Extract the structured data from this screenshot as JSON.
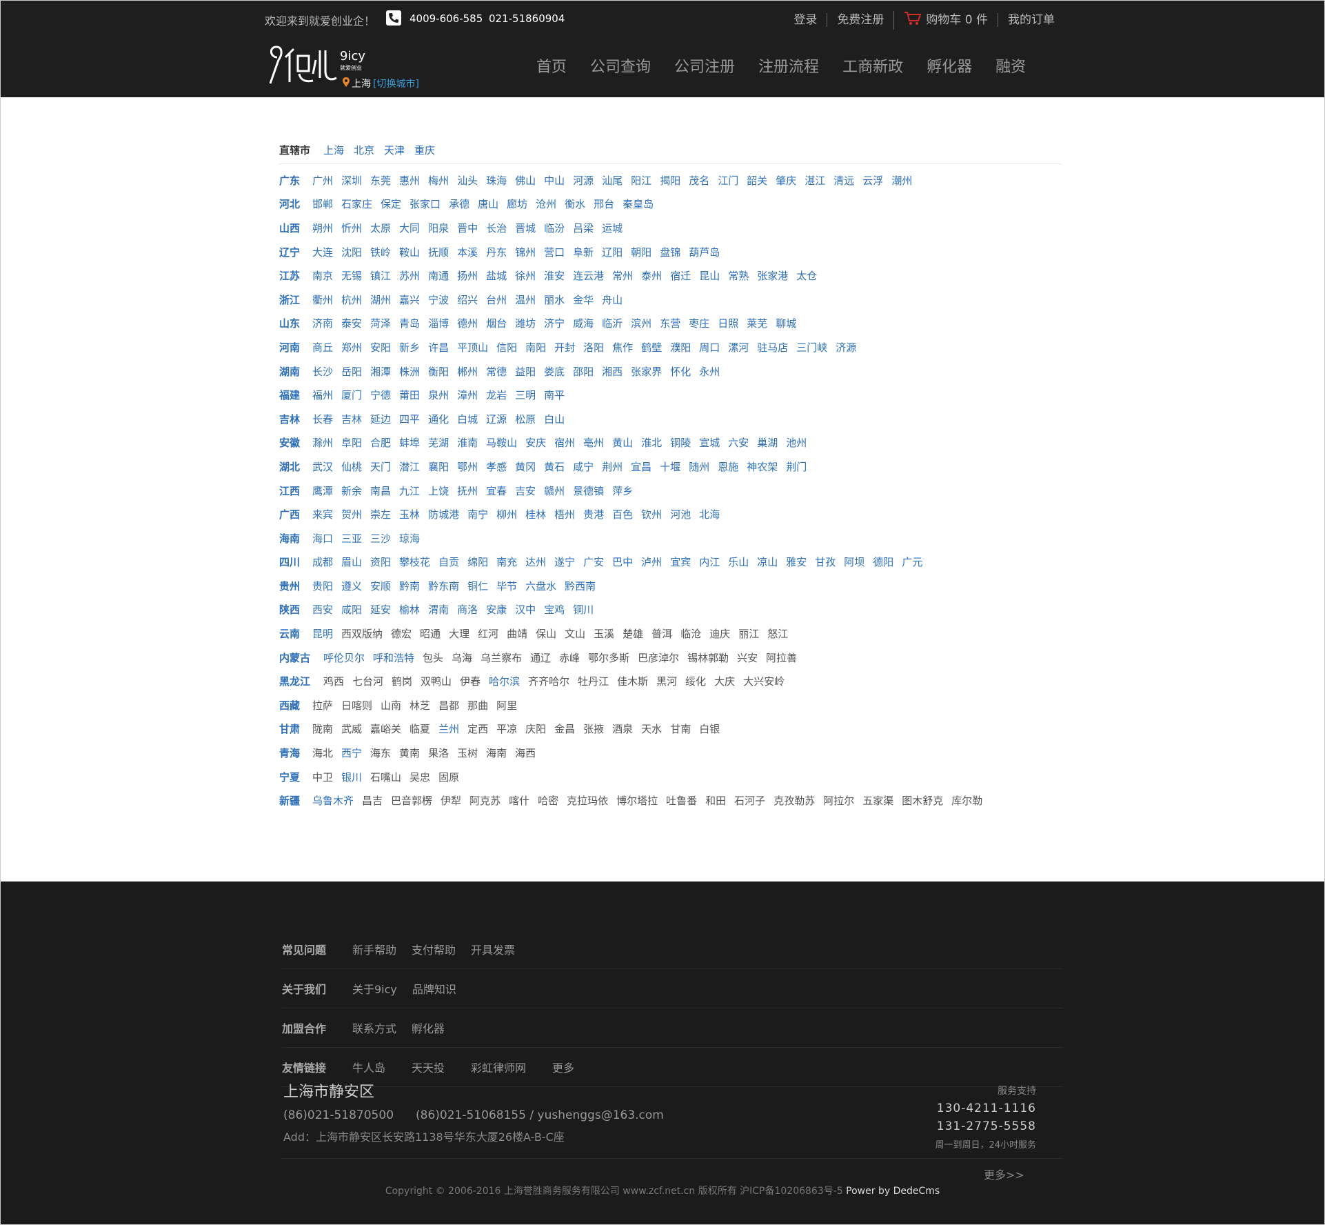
{
  "header": {
    "welcome": "欢迎来到就爱创业企！",
    "phone1": "4009-606-585",
    "phone2": "021-51860904",
    "links": {
      "login": "登录",
      "register": "免费注册",
      "cart": "购物车 0 件",
      "orders": "我的订单"
    },
    "logo_text": "9icy",
    "logo_sub": "就爱创业",
    "city": "上海",
    "switch_city": "[切换城市]",
    "nav": [
      "首页",
      "公司查询",
      "公司注册",
      "注册流程",
      "工商新政",
      "孵化器",
      "融资"
    ]
  },
  "municipalities": {
    "label": "直辖市",
    "cities": [
      "上海",
      "北京",
      "天津",
      "重庆"
    ]
  },
  "provinces": [
    {
      "name": "广东",
      "cities": [
        "广州",
        "深圳",
        "东莞",
        "惠州",
        "梅州",
        "汕头",
        "珠海",
        "佛山",
        "中山",
        "河源",
        "汕尾",
        "阳江",
        "揭阳",
        "茂名",
        "江门",
        "韶关",
        "肇庆",
        "湛江",
        "清远",
        "云浮",
        "潮州"
      ]
    },
    {
      "name": "河北",
      "cities": [
        "邯郸",
        "石家庄",
        "保定",
        "张家口",
        "承德",
        "唐山",
        "廊坊",
        "沧州",
        "衡水",
        "邢台",
        "秦皇岛"
      ]
    },
    {
      "name": "山西",
      "cities": [
        "朔州",
        "忻州",
        "太原",
        "大同",
        "阳泉",
        "晋中",
        "长治",
        "晋城",
        "临汾",
        "吕梁",
        "运城"
      ]
    },
    {
      "name": "辽宁",
      "cities": [
        "大连",
        "沈阳",
        "铁岭",
        "鞍山",
        "抚顺",
        "本溪",
        "丹东",
        "锦州",
        "营口",
        "阜新",
        "辽阳",
        "朝阳",
        "盘锦",
        "葫芦岛"
      ]
    },
    {
      "name": "江苏",
      "cities": [
        "南京",
        "无锡",
        "镇江",
        "苏州",
        "南通",
        "扬州",
        "盐城",
        "徐州",
        "淮安",
        "连云港",
        "常州",
        "泰州",
        "宿迁",
        "昆山",
        "常熟",
        "张家港",
        "太仓"
      ]
    },
    {
      "name": "浙江",
      "cities": [
        "衢州",
        "杭州",
        "湖州",
        "嘉兴",
        "宁波",
        "绍兴",
        "台州",
        "温州",
        "丽水",
        "金华",
        "舟山"
      ]
    },
    {
      "name": "山东",
      "cities": [
        "济南",
        "泰安",
        "菏泽",
        "青岛",
        "淄博",
        "德州",
        "烟台",
        "潍坊",
        "济宁",
        "威海",
        "临沂",
        "滨州",
        "东营",
        "枣庄",
        "日照",
        "莱芜",
        "聊城"
      ]
    },
    {
      "name": "河南",
      "cities": [
        "商丘",
        "郑州",
        "安阳",
        "新乡",
        "许昌",
        "平顶山",
        "信阳",
        "南阳",
        "开封",
        "洛阳",
        "焦作",
        "鹤壁",
        "濮阳",
        "周口",
        "漯河",
        "驻马店",
        "三门峡",
        "济源"
      ]
    },
    {
      "name": "湖南",
      "cities": [
        "长沙",
        "岳阳",
        "湘潭",
        "株洲",
        "衡阳",
        "郴州",
        "常德",
        "益阳",
        "娄底",
        "邵阳",
        "湘西",
        "张家界",
        "怀化",
        "永州"
      ]
    },
    {
      "name": "福建",
      "cities": [
        "福州",
        "厦门",
        "宁德",
        "莆田",
        "泉州",
        "漳州",
        "龙岩",
        "三明",
        "南平"
      ]
    },
    {
      "name": "吉林",
      "cities": [
        "长春",
        "吉林",
        "延边",
        "四平",
        "通化",
        "白城",
        "辽源",
        "松原",
        "白山"
      ]
    },
    {
      "name": "安徽",
      "cities": [
        "滁州",
        "阜阳",
        "合肥",
        "蚌埠",
        "芜湖",
        "淮南",
        "马鞍山",
        "安庆",
        "宿州",
        "亳州",
        "黄山",
        "淮北",
        "铜陵",
        "宣城",
        "六安",
        "巢湖",
        "池州"
      ]
    },
    {
      "name": "湖北",
      "cities": [
        "武汉",
        "仙桃",
        "天门",
        "潜江",
        "襄阳",
        "鄂州",
        "孝感",
        "黄冈",
        "黄石",
        "咸宁",
        "荆州",
        "宜昌",
        "十堰",
        "随州",
        "恩施",
        "神农架",
        "荆门"
      ]
    },
    {
      "name": "江西",
      "cities": [
        "鹰潭",
        "新余",
        "南昌",
        "九江",
        "上饶",
        "抚州",
        "宜春",
        "吉安",
        "赣州",
        "景德镇",
        "萍乡"
      ]
    },
    {
      "name": "广西",
      "cities": [
        "来宾",
        "贺州",
        "崇左",
        "玉林",
        "防城港",
        "南宁",
        "柳州",
        "桂林",
        "梧州",
        "贵港",
        "百色",
        "钦州",
        "河池",
        "北海"
      ]
    },
    {
      "name": "海南",
      "cities": [
        "海口",
        "三亚",
        "三沙",
        "琼海"
      ]
    },
    {
      "name": "四川",
      "cities": [
        "成都",
        "眉山",
        "资阳",
        "攀枝花",
        "自贡",
        "绵阳",
        "南充",
        "达州",
        "遂宁",
        "广安",
        "巴中",
        "泸州",
        "宜宾",
        "内江",
        "乐山",
        "凉山",
        "雅安",
        "甘孜",
        "阿坝",
        "德阳",
        "广元"
      ]
    },
    {
      "name": "贵州",
      "cities": [
        "贵阳",
        "遵义",
        "安顺",
        "黔南",
        "黔东南",
        "铜仁",
        "毕节",
        "六盘水",
        "黔西南"
      ]
    },
    {
      "name": "陕西",
      "cities": [
        "西安",
        "咸阳",
        "延安",
        "榆林",
        "渭南",
        "商洛",
        "安康",
        "汉中",
        "宝鸡",
        "铜川"
      ]
    },
    {
      "name": "云南",
      "cities": [
        "昆明",
        "西双版纳",
        "德宏",
        "昭通",
        "大理",
        "红河",
        "曲靖",
        "保山",
        "文山",
        "玉溪",
        "楚雄",
        "普洱",
        "临沧",
        "迪庆",
        "丽江",
        "怒江"
      ]
    },
    {
      "name": "内蒙古",
      "cities": [
        "呼伦贝尔",
        "呼和浩特",
        "包头",
        "乌海",
        "乌兰察布",
        "通辽",
        "赤峰",
        "鄂尔多斯",
        "巴彦淖尔",
        "锡林郭勒",
        "兴安",
        "阿拉善"
      ]
    },
    {
      "name": "黑龙江",
      "cities": [
        "鸡西",
        "七台河",
        "鹤岗",
        "双鸭山",
        "伊春",
        "哈尔滨",
        "齐齐哈尔",
        "牡丹江",
        "佳木斯",
        "黑河",
        "绥化",
        "大庆",
        "大兴安岭"
      ]
    },
    {
      "name": "西藏",
      "cities": [
        "拉萨",
        "日喀则",
        "山南",
        "林芝",
        "昌都",
        "那曲",
        "阿里"
      ]
    },
    {
      "name": "甘肃",
      "cities": [
        "陇南",
        "武威",
        "嘉峪关",
        "临夏",
        "兰州",
        "定西",
        "平凉",
        "庆阳",
        "金昌",
        "张掖",
        "酒泉",
        "天水",
        "甘南",
        "白银"
      ]
    },
    {
      "name": "青海",
      "cities": [
        "海北",
        "西宁",
        "海东",
        "黄南",
        "果洛",
        "玉树",
        "海南",
        "海西"
      ]
    },
    {
      "name": "宁夏",
      "cities": [
        "中卫",
        "银川",
        "石嘴山",
        "吴忠",
        "固原"
      ]
    },
    {
      "name": "新疆",
      "cities": [
        "乌鲁木齐",
        "昌吉",
        "巴音郭楞",
        "伊犁",
        "阿克苏",
        "喀什",
        "哈密",
        "克拉玛依",
        "博尔塔拉",
        "吐鲁番",
        "和田",
        "石河子",
        "克孜勒苏",
        "阿拉尔",
        "五家渠",
        "图木舒克",
        "库尔勒"
      ]
    }
  ],
  "highlight_cities": [
    "广州",
    "深圳",
    "东莞",
    "惠州",
    "梅州",
    "汕头",
    "珠海",
    "佛山",
    "中山",
    "河源",
    "汕尾",
    "阳江",
    "揭阳",
    "茂名",
    "江门",
    "韶关",
    "肇庆",
    "湛江",
    "清远",
    "云浮",
    "潮州",
    "邯郸",
    "石家庄",
    "保定",
    "张家口",
    "承德",
    "唐山",
    "廊坊",
    "沧州",
    "衡水",
    "邢台",
    "秦皇岛",
    "朔州",
    "忻州",
    "太原",
    "大同",
    "阳泉",
    "晋中",
    "长治",
    "晋城",
    "临汾",
    "吕梁",
    "运城",
    "大连",
    "沈阳",
    "铁岭",
    "鞍山",
    "抚顺",
    "本溪",
    "丹东",
    "锦州",
    "营口",
    "阜新",
    "辽阳",
    "朝阳",
    "盘锦",
    "葫芦岛",
    "南京",
    "无锡",
    "镇江",
    "苏州",
    "南通",
    "扬州",
    "盐城",
    "徐州",
    "淮安",
    "连云港",
    "常州",
    "泰州",
    "宿迁",
    "昆山",
    "常熟",
    "张家港",
    "太仓",
    "衢州",
    "杭州",
    "湖州",
    "嘉兴",
    "宁波",
    "绍兴",
    "台州",
    "温州",
    "丽水",
    "金华",
    "舟山",
    "济南",
    "泰安",
    "菏泽",
    "青岛",
    "淄博",
    "德州",
    "烟台",
    "潍坊",
    "济宁",
    "威海",
    "临沂",
    "滨州",
    "东营",
    "枣庄",
    "日照",
    "莱芜",
    "聊城",
    "商丘",
    "郑州",
    "安阳",
    "新乡",
    "许昌",
    "平顶山",
    "信阳",
    "南阳",
    "开封",
    "洛阳",
    "焦作",
    "鹤壁",
    "濮阳",
    "周口",
    "漯河",
    "驻马店",
    "三门峡",
    "济源",
    "长沙",
    "岳阳",
    "湘潭",
    "株洲",
    "衡阳",
    "郴州",
    "常德",
    "益阳",
    "娄底",
    "邵阳",
    "湘西",
    "张家界",
    "怀化",
    "永州",
    "福州",
    "厦门",
    "宁德",
    "莆田",
    "泉州",
    "漳州",
    "龙岩",
    "三明",
    "南平",
    "长春",
    "吉林",
    "延边",
    "四平",
    "通化",
    "白城",
    "辽源",
    "松原",
    "白山",
    "滁州",
    "阜阳",
    "合肥",
    "蚌埠",
    "芜湖",
    "淮南",
    "马鞍山",
    "安庆",
    "宿州",
    "亳州",
    "黄山",
    "淮北",
    "铜陵",
    "宣城",
    "六安",
    "巢湖",
    "池州",
    "武汉",
    "仙桃",
    "天门",
    "潜江",
    "襄阳",
    "鄂州",
    "孝感",
    "黄冈",
    "黄石",
    "咸宁",
    "荆州",
    "宜昌",
    "十堰",
    "随州",
    "恩施",
    "神农架",
    "荆门",
    "鹰潭",
    "新余",
    "南昌",
    "九江",
    "上饶",
    "抚州",
    "宜春",
    "吉安",
    "赣州",
    "景德镇",
    "萍乡",
    "来宾",
    "贺州",
    "崇左",
    "玉林",
    "防城港",
    "南宁",
    "柳州",
    "桂林",
    "梧州",
    "贵港",
    "百色",
    "钦州",
    "河池",
    "北海",
    "海口",
    "三亚",
    "三沙",
    "琼海",
    "成都",
    "眉山",
    "资阳",
    "攀枝花",
    "自贡",
    "绵阳",
    "南充",
    "达州",
    "遂宁",
    "广安",
    "巴中",
    "泸州",
    "宜宾",
    "内江",
    "乐山",
    "凉山",
    "雅安",
    "甘孜",
    "阿坝",
    "德阳",
    "广元",
    "贵阳",
    "遵义",
    "安顺",
    "黔南",
    "黔东南",
    "铜仁",
    "毕节",
    "六盘水",
    "黔西南",
    "西安",
    "咸阳",
    "延安",
    "榆林",
    "渭南",
    "商洛",
    "安康",
    "汉中",
    "宝鸡",
    "铜川",
    "昆明",
    "呼伦贝尔",
    "呼和浩特",
    "哈尔滨",
    "银川",
    "西宁",
    "兰州",
    "乌鲁木齐"
  ],
  "footer": {
    "rows": [
      {
        "title": "常见问题",
        "links": [
          "新手帮助",
          "支付帮助",
          "开具发票"
        ]
      },
      {
        "title": "关于我们",
        "links": [
          "关于9icy",
          "品牌知识"
        ]
      },
      {
        "title": "加盟合作",
        "links": [
          "联系方式",
          "孵化器"
        ]
      },
      {
        "title": "友情链接",
        "links": [
          "牛人岛",
          "天天投",
          "彩虹律师网",
          "更多"
        ]
      }
    ],
    "city": "上海市静安区",
    "contact1": "(86)021-51870500",
    "contact2": "(86)021-51068155 / yushenggs@163.com",
    "address": "Add：上海市静安区长安路1138号华东大厦26楼A-B-C座",
    "support_title": "服务支持",
    "tel1": "130-4211-1116",
    "tel2": "131-2775-5558",
    "hours": "周一到周日，24小时服务",
    "more": "更多>>",
    "copyright": "Copyright © 2006-2016 上海誉胜商务服务有限公司 www.zcf.net.cn  版权所有  沪ICP备10206863号-5 ",
    "power": "Power by DedeCms"
  },
  "colors": {
    "link_blue": "#2e6fb8",
    "header_bg": "#1e1e1e",
    "footer_bg": "#1b1b1b"
  }
}
